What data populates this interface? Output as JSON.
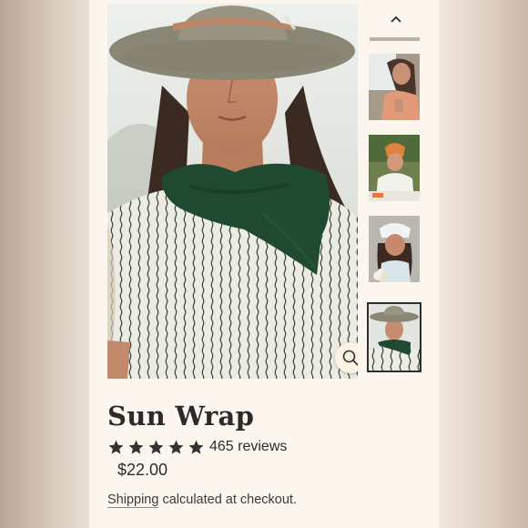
{
  "product": {
    "title": "Sun Wrap",
    "rating_stars": 5,
    "reviews_label": "465 reviews",
    "price": "$22.00",
    "shipping_link": "Shipping",
    "shipping_text": " calculated at checkout."
  },
  "gallery": {
    "main_image": "woman-in-hat-green-scarf-photo",
    "zoom_icon": "magnifier-icon",
    "scroll_up_icon": "chevron-up-icon",
    "thumbnails": [
      {
        "image": "woman-peach-wrap-photo",
        "active": false
      },
      {
        "image": "woman-orange-headwrap-photo",
        "active": false
      },
      {
        "image": "woman-white-headwrap-flowers-photo",
        "active": false
      },
      {
        "image": "woman-hat-green-scarf-photo",
        "active": true
      }
    ]
  },
  "colors": {
    "background": "#fdf6ef",
    "text": "#2b2b2b",
    "scarf_green": "#1f4a30",
    "star": "#333333"
  }
}
